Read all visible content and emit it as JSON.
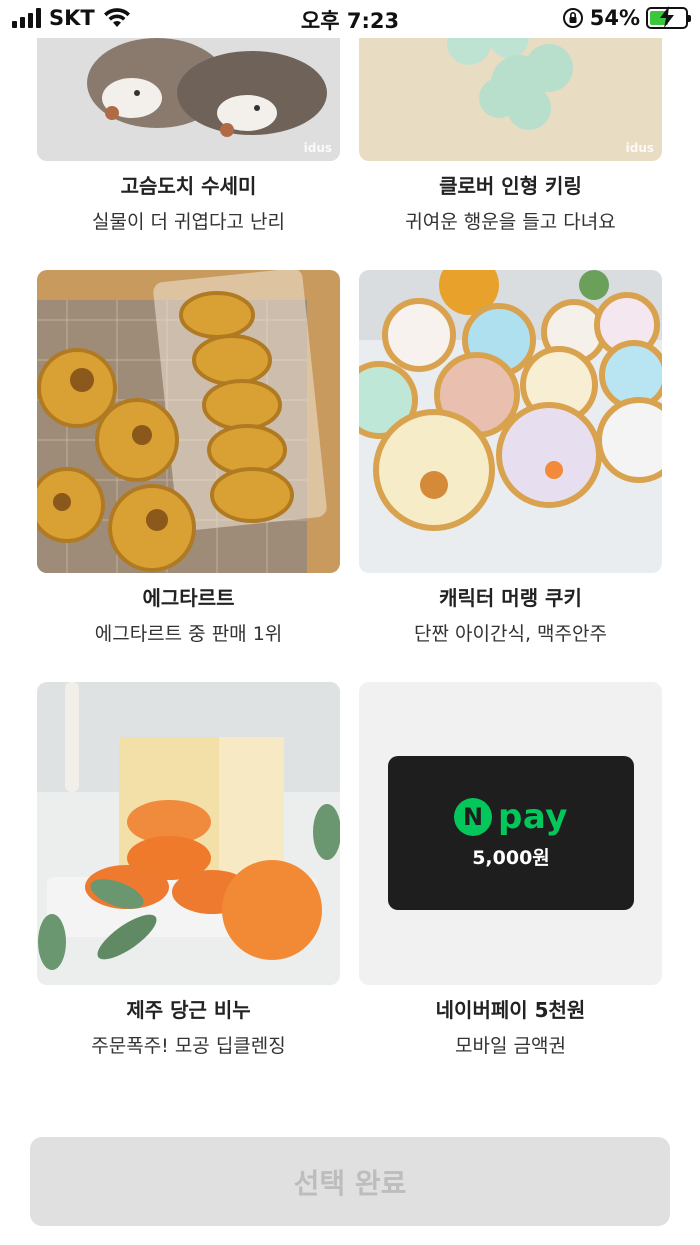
{
  "status_bar": {
    "carrier": "SKT",
    "time": "오후 7:23",
    "battery": "54%",
    "battery_level": 0.54
  },
  "products": [
    {
      "title": "고슴도치 수세미",
      "subtitle": "실물이 더 귀엽다고 난리",
      "watermark": "idus"
    },
    {
      "title": "클로버 인형 키링",
      "subtitle": "귀여운 행운을 들고 다녀요",
      "watermark": "idus"
    },
    {
      "title": "에그타르트",
      "subtitle": "에그타르트 중 판매 1위"
    },
    {
      "title": "캐릭터 머랭 쿠키",
      "subtitle": "단짠 아이간식, 맥주안주"
    },
    {
      "title": "제주 당근 비누",
      "subtitle": "주문폭주! 모공 딥클렌징"
    },
    {
      "title": "네이버페이 5천원",
      "subtitle": "모바일 금액권",
      "npay": {
        "logo_letter": "N",
        "logo_word": "pay",
        "amount": "5,000원"
      }
    }
  ],
  "colors": {
    "npay_green": "#03c75a",
    "button_bg": "#e0e0e0",
    "button_text": "#bdbdbd"
  },
  "complete_button": {
    "label": "선택 완료"
  }
}
